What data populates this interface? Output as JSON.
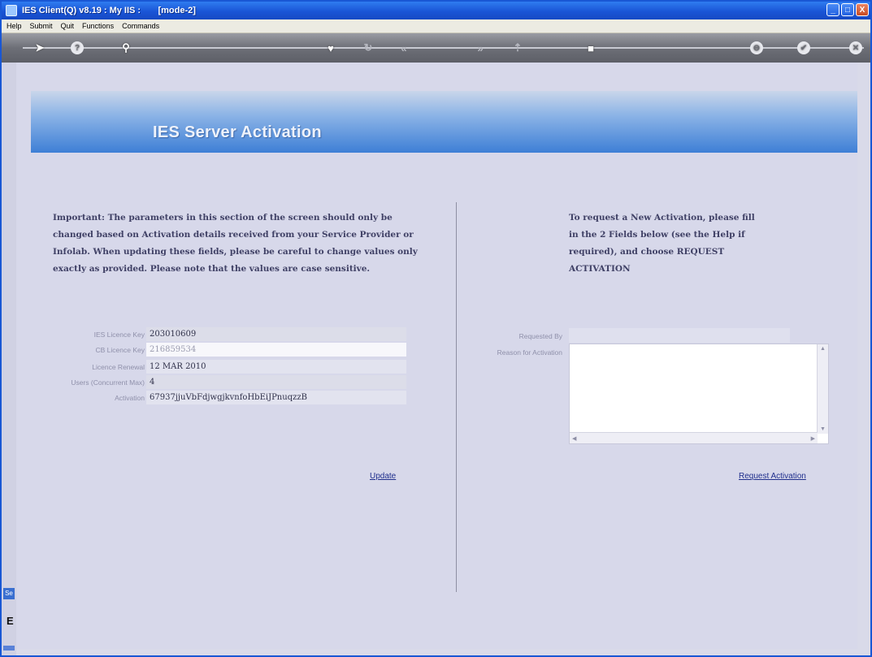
{
  "window": {
    "title": "IES Client(Q) v8.19 : My IIS :       [mode-2]",
    "minimize": "_",
    "maximize": "□",
    "close": "X"
  },
  "menu": [
    "Help",
    "Submit",
    "Quit",
    "Functions",
    "Commands"
  ],
  "toolbar": {
    "icons": [
      "arrow-right-icon",
      "help-icon",
      "search-icon",
      "heart-icon",
      "refresh-icon",
      "rewind-icon",
      "fast-forward-icon",
      "upload-icon",
      "stop-icon",
      "cancel-icon",
      "ok-icon",
      "close-icon"
    ]
  },
  "banner": {
    "title": "IES Server Activation"
  },
  "left_note": "Important: The parameters in this section of the screen should only be changed based on Activation details received from your Service Provider or Infolab. When updating  these fields, please be careful to change values only exactly as  provided. Please note that the values are case sensitive.",
  "right_note": "To request a New Activation, please fill in the 2 Fields below (see the Help if required), and choose REQUEST ACTIVATION",
  "fields": {
    "ies_licence_key": {
      "label": "IES Licence Key",
      "value": "203010609"
    },
    "cb_licence_key": {
      "label": "CB Licence Key",
      "value": "216859534"
    },
    "licence_renewal": {
      "label": "Licence Renewal",
      "value": "12 MAR 2010"
    },
    "users": {
      "label": "Users (Concurrent Max)",
      "value": "4"
    },
    "activation": {
      "label": "Activation",
      "value": "67937jjuVbFdjwgjkvnfoHbEiJPnuqzzB"
    }
  },
  "update_link": "Update",
  "request": {
    "requested_by_label": "Requested By",
    "reason_label": "Reason for Activation",
    "requested_by_value": "",
    "reason_value": ""
  },
  "request_link": "Request Activation",
  "left_strip": {
    "mini": "Se",
    "letter": "E"
  }
}
